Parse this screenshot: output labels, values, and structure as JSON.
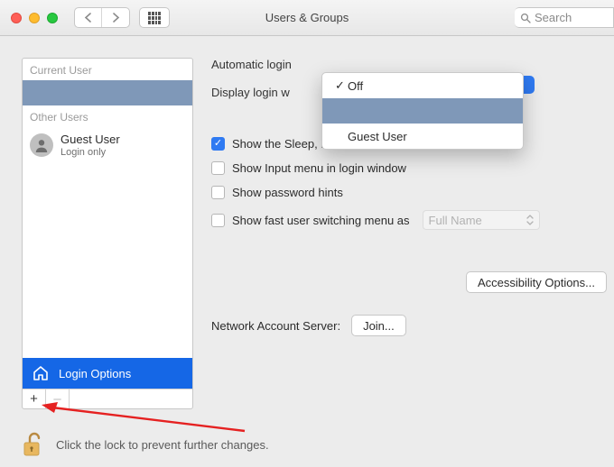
{
  "window_title": "Users & Groups",
  "search_placeholder": "Search",
  "sidebar": {
    "section_current": "Current User",
    "section_other": "Other Users",
    "guest_name": "Guest User",
    "guest_sub": "Login only",
    "login_options": "Login Options"
  },
  "labels": {
    "automatic_login": "Automatic login",
    "display_login": "Display login w"
  },
  "popup": {
    "off": "Off",
    "guest": "Guest User"
  },
  "checks": {
    "sleep": "Show the Sleep, Restart, and Shut Down buttons",
    "input_menu": "Show Input menu in login window",
    "pw_hints": "Show password hints",
    "fast_switch": "Show fast user switching menu as"
  },
  "fast_switch_value": "Full Name",
  "buttons": {
    "accessibility": "Accessibility Options...",
    "join": "Join..."
  },
  "network_label": "Network Account Server:",
  "lock_text": "Click the lock to prevent further changes."
}
